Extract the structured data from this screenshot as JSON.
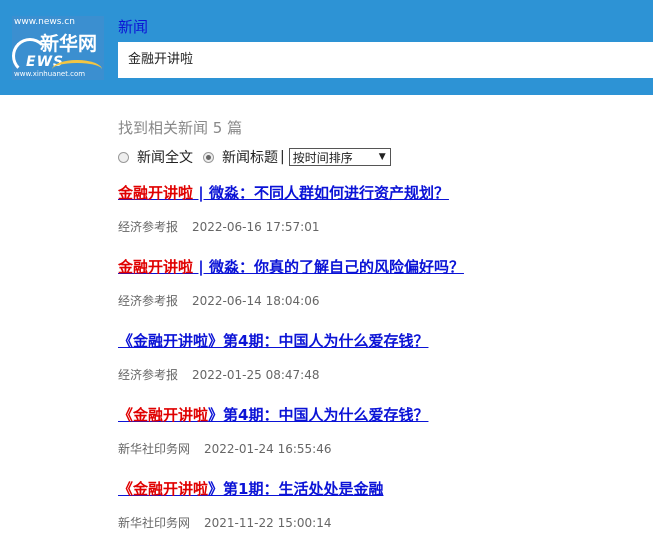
{
  "header": {
    "logo_url_top": "www.news.cn",
    "logo_cn": "新华网",
    "logo_letters": "EWS",
    "logo_url_bottom": "www.xinhuanet.com",
    "nav_label": "新闻",
    "search_value": "金融开讲啦"
  },
  "results": {
    "count_label": "找到相关新闻  5  篇",
    "filter_fulltext": "新闻全文",
    "filter_title": "新闻标题",
    "separator": "|",
    "sort_selected": "按时间排序"
  },
  "items": [
    {
      "keyword": "金融开讲啦",
      "title_rest": " | 微淼：不同人群如何进行资产规划？",
      "source": "经济参考报",
      "date": "2022-06-16 17:57:01"
    },
    {
      "keyword": "金融开讲啦",
      "title_rest": " | 微淼：你真的了解自己的风险偏好吗？",
      "source": "经济参考报",
      "date": "2022-06-14 18:04:06"
    },
    {
      "keyword": "《金融开讲啦",
      "title_rest": "》第4期：中国人为什么爱存钱？",
      "source": "经济参考报",
      "date": "2022-01-25 08:47:48",
      "kw_blue": true
    },
    {
      "keyword": "《金融开讲啦",
      "title_rest": "》第4期：中国人为什么爱存钱？",
      "source": "新华社印务网",
      "date": "2022-01-24 16:55:46"
    },
    {
      "keyword": "《金融开讲啦",
      "title_rest": "》第1期：生活处处是金融",
      "source": "新华社印务网",
      "date": "2021-11-22 15:00:14"
    }
  ]
}
